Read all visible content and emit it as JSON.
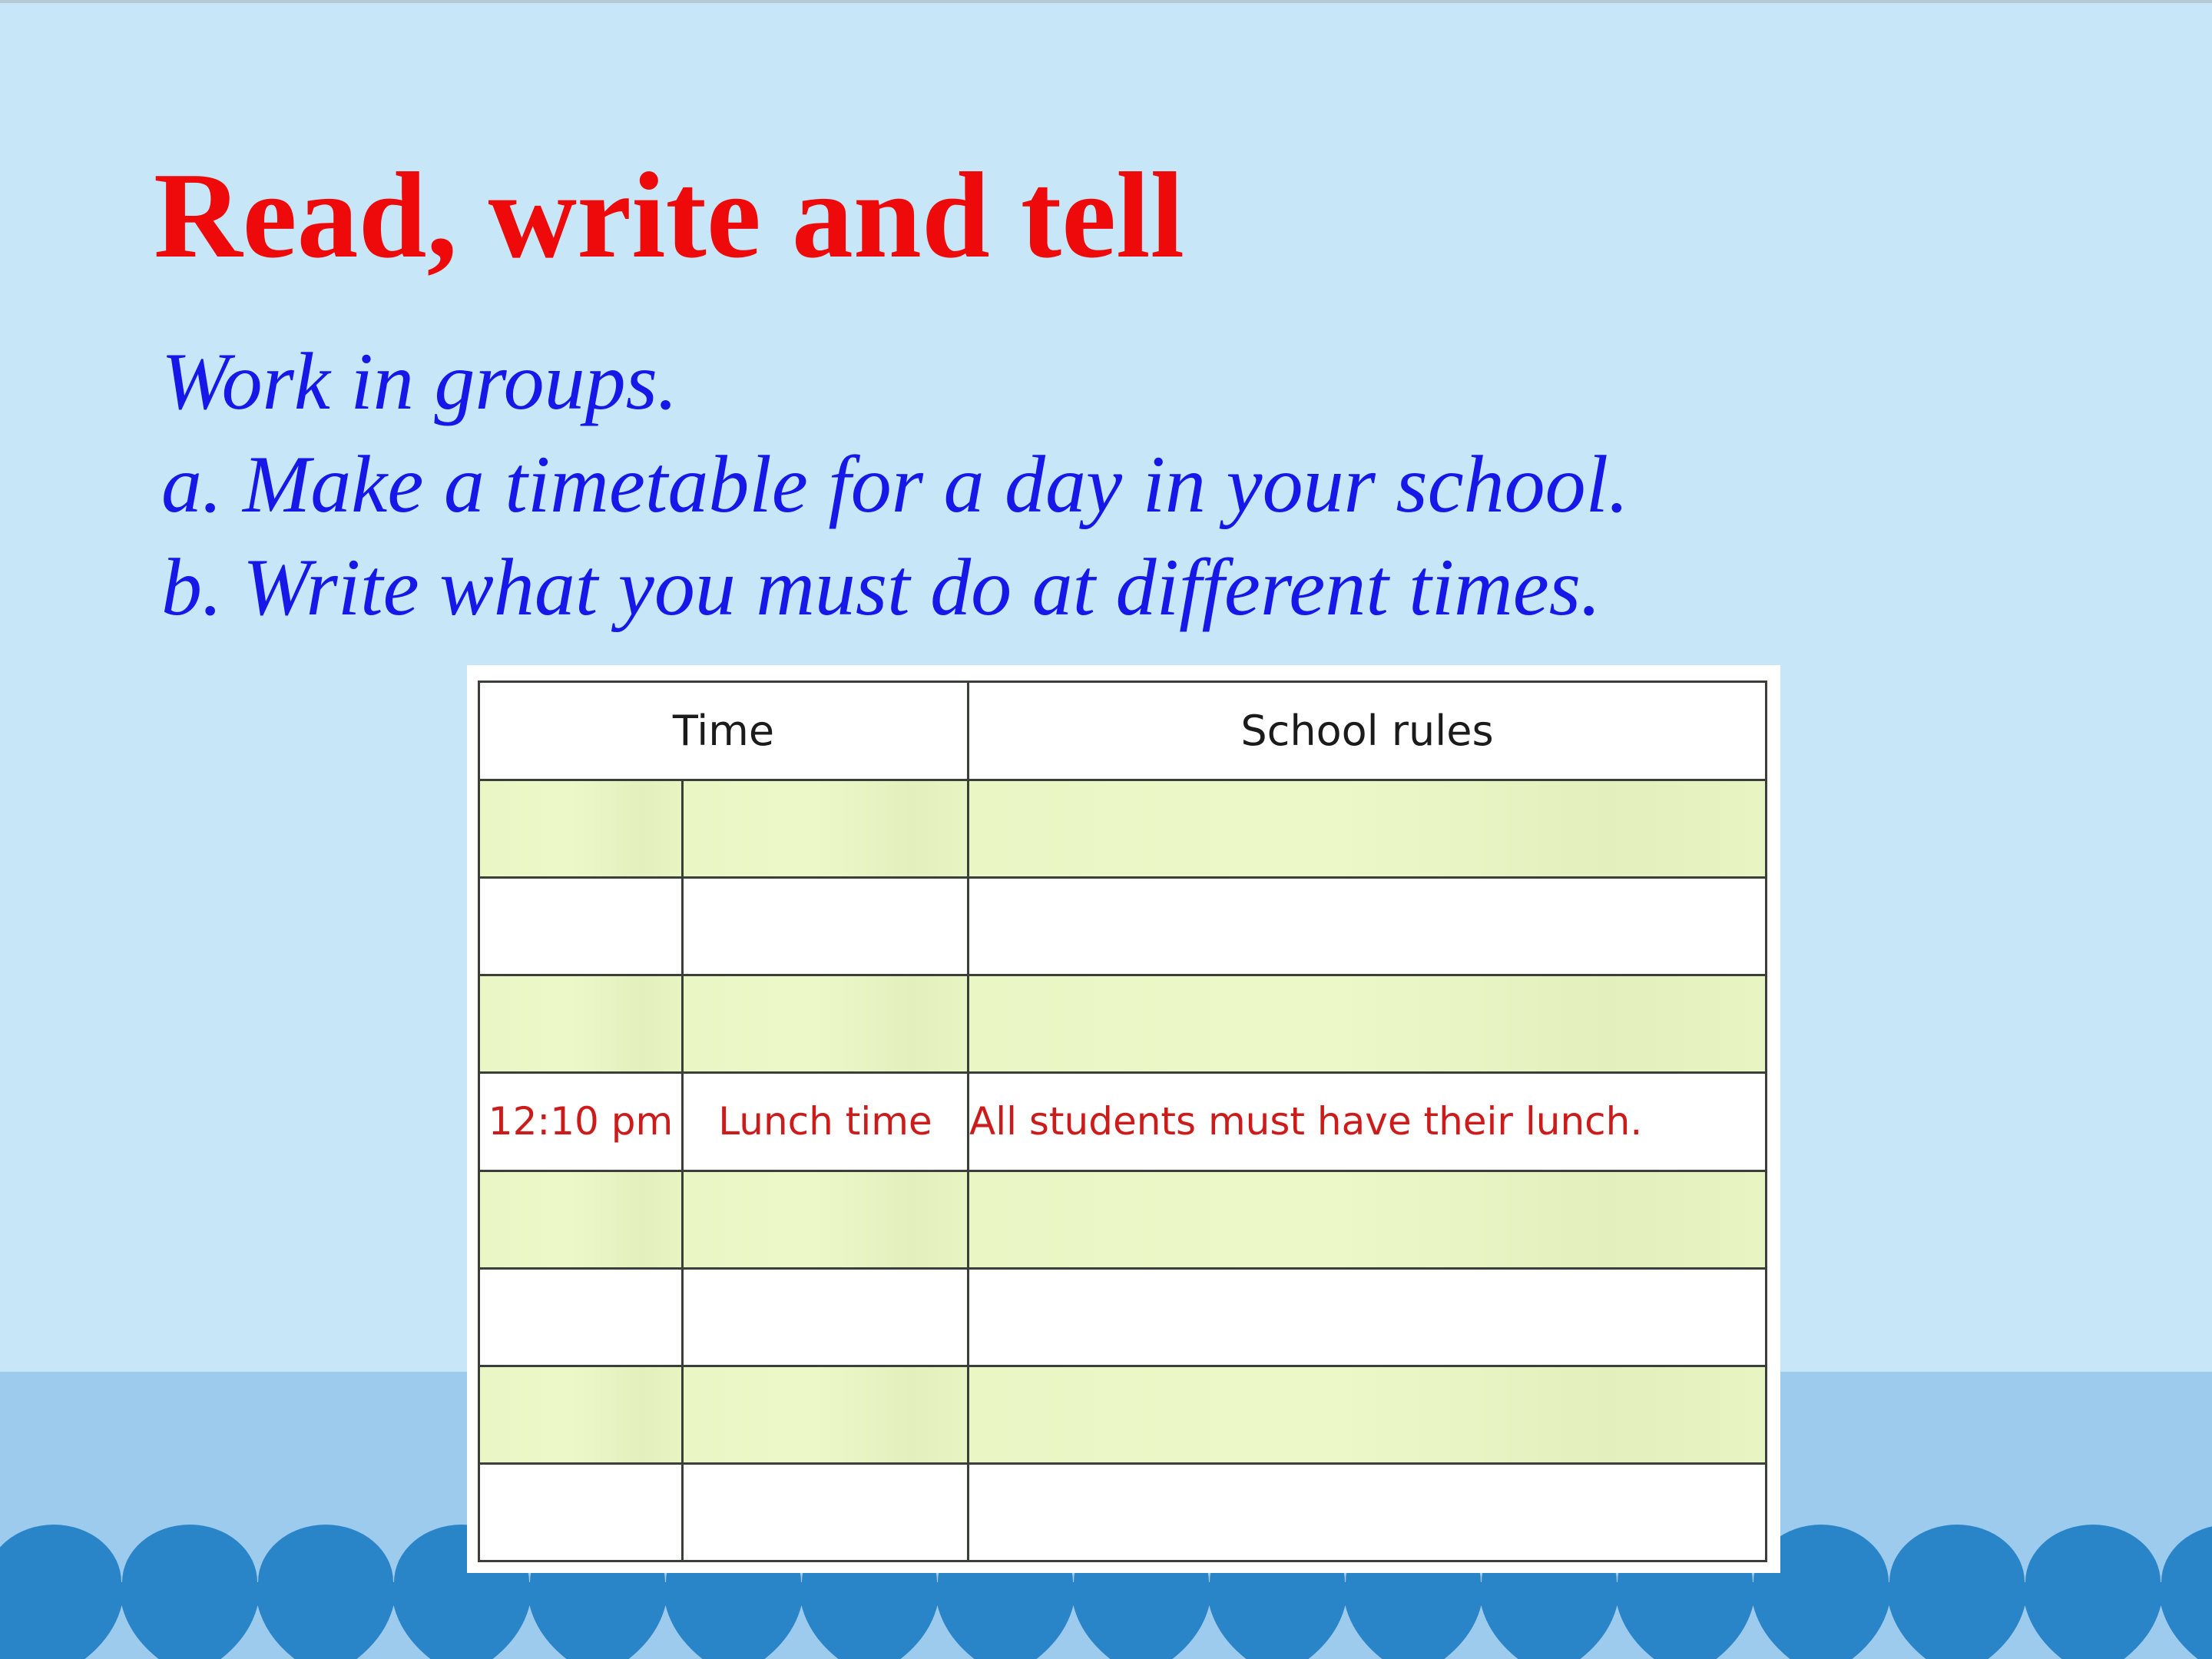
{
  "slide": {
    "title": "Read, write and tell",
    "instructions": [
      "Work in groups.",
      "a. Make a timetable for a day in your school.",
      "b. Write what you must do at different times."
    ]
  },
  "timetable": {
    "headers": {
      "time": "Time",
      "rules": "School rules"
    },
    "rows": [
      {
        "clock": "",
        "event": "",
        "rule": ""
      },
      {
        "clock": "",
        "event": "",
        "rule": ""
      },
      {
        "clock": "",
        "event": "",
        "rule": ""
      },
      {
        "clock": "12:10 pm",
        "event": "Lunch time",
        "rule": "All students must have their lunch."
      },
      {
        "clock": "",
        "event": "",
        "rule": ""
      },
      {
        "clock": "",
        "event": "",
        "rule": ""
      },
      {
        "clock": "",
        "event": "",
        "rule": ""
      },
      {
        "clock": "",
        "event": "",
        "rule": ""
      }
    ]
  },
  "colors": {
    "background": "#c7e7f8",
    "title": "#ee0a0a",
    "instructions": "#1717e8",
    "example_text": "#cc1b1b",
    "row_highlight": "#eaf6c4",
    "wave": "#2a84c8"
  }
}
